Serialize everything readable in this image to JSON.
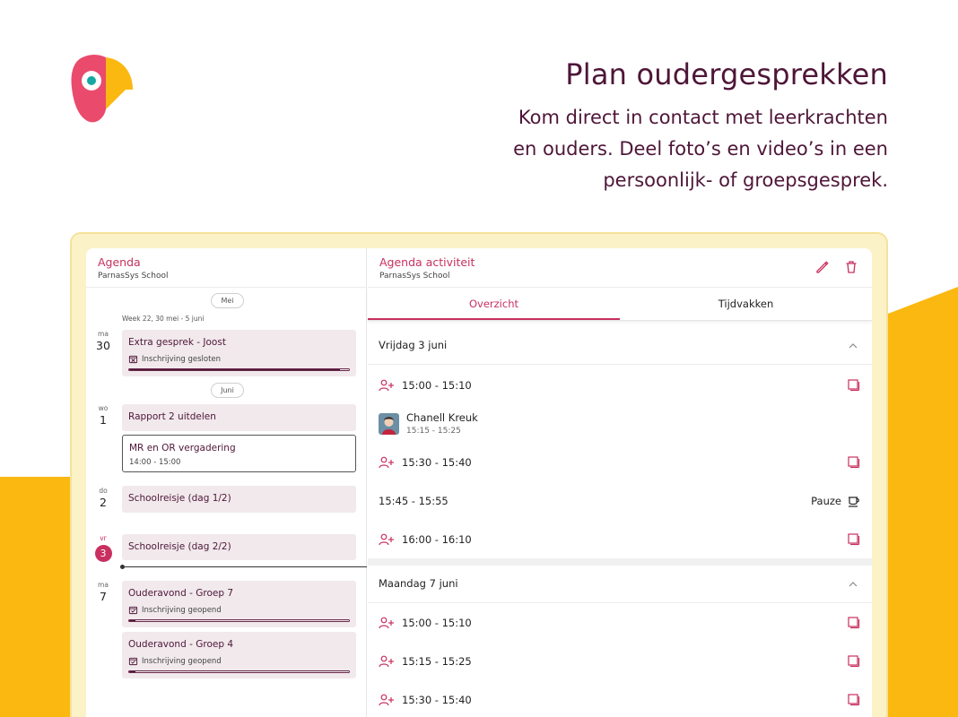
{
  "colors": {
    "brand": "#c8305f",
    "dark_purple": "#4e1638",
    "yellow": "#fbb811"
  },
  "promo": {
    "headline": "Plan oudergesprekken",
    "body": "Kom direct in contact met leerkrachten en ouders. Deel foto’s en video’s in een persoonlijk- of groepsgesprek."
  },
  "agenda": {
    "title": "Agenda",
    "school": "ParnasSys School",
    "month_mei": "Mei",
    "month_juni": "Juni",
    "week_label": "Week 22, 30 mei - 5 juni",
    "days": [
      {
        "dn": "ma",
        "dd": "30"
      },
      {
        "dn": "wo",
        "dd": "1"
      },
      {
        "dn": "do",
        "dd": "2"
      },
      {
        "dn": "vr",
        "dd": "3"
      },
      {
        "dn": "ma",
        "dd": "7"
      }
    ],
    "events": [
      {
        "title": "Extra gesprek - Joost",
        "status": "Inschrijving gesloten",
        "progress": 0.96
      },
      {
        "title": "Rapport 2 uitdelen"
      },
      {
        "title": "MR en OR vergadering",
        "time": "14:00 - 15:00"
      },
      {
        "title": "Schoolreisje (dag 1/2)"
      },
      {
        "title": "Schoolreisje (dag 2/2)"
      },
      {
        "title": "Ouderavond - Groep 7",
        "status": "Inschrijving geopend",
        "progress": 0.03
      },
      {
        "title": "Ouderavond - Groep 4",
        "status": "Inschrijving geopend",
        "progress": 0.03
      }
    ]
  },
  "activity": {
    "title": "Agenda activiteit",
    "school": "ParnasSys School",
    "tabs": [
      "Overzicht",
      "Tijdvakken"
    ],
    "sections": [
      {
        "date": "Vrijdag 3 juni",
        "slot1": "15:00 - 15:10",
        "person_name": "Chanell Kreuk",
        "person_time": "15:15 - 15:25",
        "slot2": "15:30 - 15:40",
        "pause_time": "15:45 - 15:55",
        "pause_label": "Pauze",
        "slot3": "16:00 - 16:10"
      },
      {
        "date": "Maandag 7 juni",
        "slot1": "15:00 - 15:10",
        "slot2": "15:15 - 15:25",
        "slot3": "15:30 - 15:40"
      }
    ]
  }
}
